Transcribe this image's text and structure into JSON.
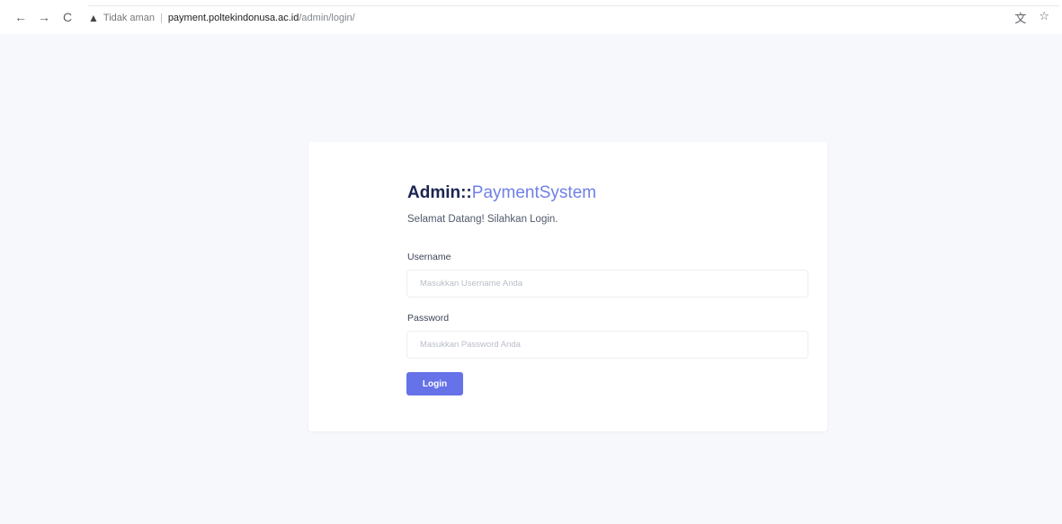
{
  "browser": {
    "back_icon": "←",
    "forward_icon": "→",
    "reload_icon": "C",
    "warning_icon": "▲",
    "not_secure_label": "Tidak aman",
    "separator": "|",
    "url_host": "payment.poltekindonusa.ac.id",
    "url_path": "/admin/login/",
    "translate_icon": "文",
    "bookmark_icon": "☆"
  },
  "login": {
    "brand_bold": "Admin::",
    "brand_light": "PaymentSystem",
    "welcome": "Selamat Datang! Silahkan Login.",
    "username_label": "Username",
    "username_placeholder": "Masukkan Username Anda",
    "username_value": "",
    "password_label": "Password",
    "password_placeholder": "Masukkan Password Anda",
    "password_value": "",
    "login_button": "Login"
  },
  "colors": {
    "page_background": "#f6f8fc",
    "brand_dark": "#1b2552",
    "brand_accent": "#6f7fe6",
    "button": "#6672e8"
  }
}
